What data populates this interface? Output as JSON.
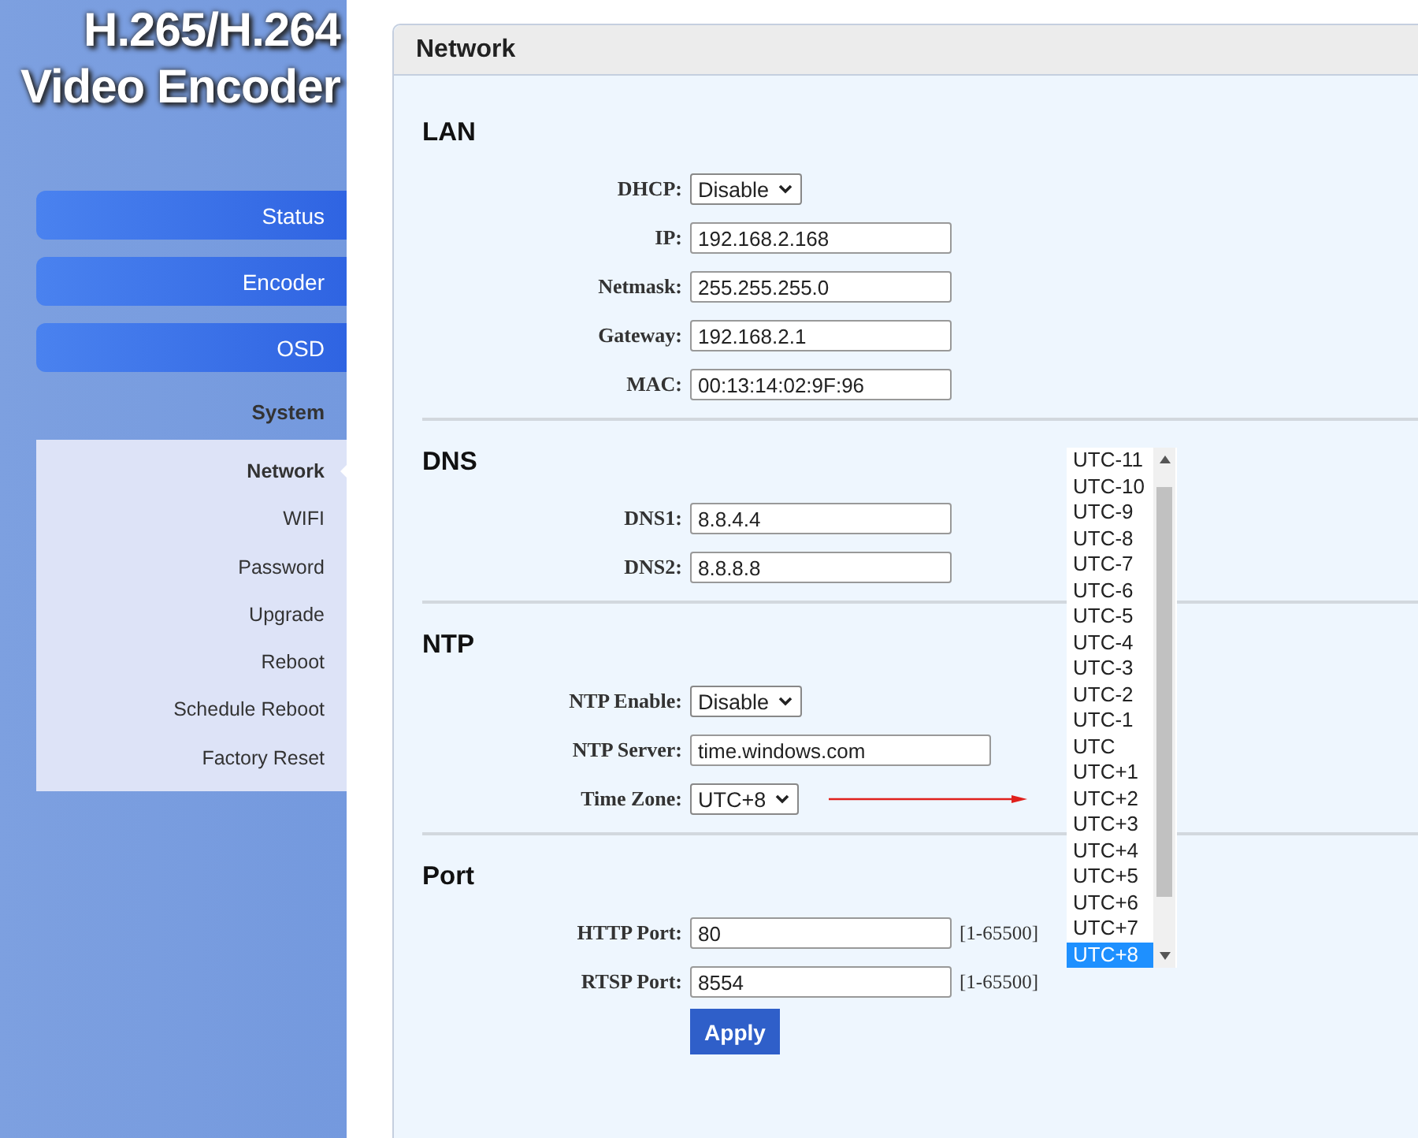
{
  "logo": {
    "lines": [
      "H.265/H.264",
      "Video Encoder"
    ]
  },
  "menu": [
    {
      "label": "Status"
    },
    {
      "label": "Encoder"
    },
    {
      "label": "OSD"
    }
  ],
  "submenu": {
    "heading": "System",
    "items": [
      {
        "label": "Network",
        "selected": true
      },
      {
        "label": "WIFI",
        "selected": false
      },
      {
        "label": "Password",
        "selected": false
      },
      {
        "label": "Upgrade",
        "selected": false
      },
      {
        "label": "Reboot",
        "selected": false
      },
      {
        "label": "Schedule Reboot",
        "selected": false
      },
      {
        "label": "Factory Reset",
        "selected": false
      }
    ]
  },
  "panel": {
    "title": "Network"
  },
  "sections": [
    {
      "title": "LAN",
      "fields": [
        {
          "label": "DHCP:",
          "kind": "select",
          "value": "Disable"
        },
        {
          "label": "IP:",
          "kind": "text",
          "value": "192.168.2.168"
        },
        {
          "label": "Netmask:",
          "kind": "text",
          "value": "255.255.255.0"
        },
        {
          "label": "Gateway:",
          "kind": "text",
          "value": "192.168.2.1"
        },
        {
          "label": "MAC:",
          "kind": "text",
          "value": "00:13:14:02:9F:96"
        }
      ]
    },
    {
      "title": "DNS",
      "fields": [
        {
          "label": "DNS1:",
          "kind": "text",
          "value": "8.8.4.4"
        },
        {
          "label": "DNS2:",
          "kind": "text",
          "value": "8.8.8.8"
        }
      ]
    },
    {
      "title": "NTP",
      "fields": [
        {
          "label": "NTP Enable:",
          "kind": "select",
          "value": "Disable"
        },
        {
          "label": "NTP Server:",
          "kind": "wide-text",
          "value": "time.windows.com"
        },
        {
          "label": "Time Zone:",
          "kind": "select",
          "value": "UTC+8",
          "pointer": true
        }
      ]
    },
    {
      "title": "Port",
      "fields": [
        {
          "label": "HTTP Port:",
          "kind": "text",
          "value": "80",
          "hint": "[1-65500]"
        },
        {
          "label": "RTSP Port:",
          "kind": "text",
          "value": "8554",
          "hint": "[1-65500]"
        }
      ]
    }
  ],
  "apply_button": "Apply",
  "timezone_list": [
    {
      "label": "UTC-11",
      "selected": false
    },
    {
      "label": "UTC-10",
      "selected": false
    },
    {
      "label": "UTC-9",
      "selected": false
    },
    {
      "label": "UTC-8",
      "selected": false
    },
    {
      "label": "UTC-7",
      "selected": false
    },
    {
      "label": "UTC-6",
      "selected": false
    },
    {
      "label": "UTC-5",
      "selected": false
    },
    {
      "label": "UTC-4",
      "selected": false
    },
    {
      "label": "UTC-3",
      "selected": false
    },
    {
      "label": "UTC-2",
      "selected": false
    },
    {
      "label": "UTC-1",
      "selected": false
    },
    {
      "label": "UTC",
      "selected": false
    },
    {
      "label": "UTC+1",
      "selected": false
    },
    {
      "label": "UTC+2",
      "selected": false
    },
    {
      "label": "UTC+3",
      "selected": false
    },
    {
      "label": "UTC+4",
      "selected": false
    },
    {
      "label": "UTC+5",
      "selected": false
    },
    {
      "label": "UTC+6",
      "selected": false
    },
    {
      "label": "UTC+7",
      "selected": false
    },
    {
      "label": "UTC+8",
      "selected": true
    }
  ]
}
